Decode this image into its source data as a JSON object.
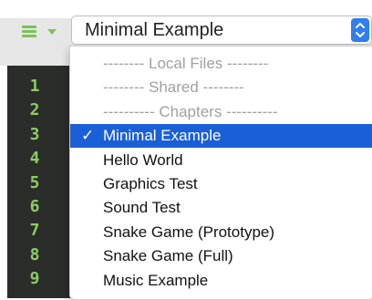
{
  "toolbar": {
    "selected_file": "Minimal Example"
  },
  "line_numbers": [
    "1",
    "2",
    "3",
    "4",
    "5",
    "6",
    "7",
    "8",
    "9"
  ],
  "menu": {
    "items": [
      {
        "label": "-------- Local Files --------",
        "type": "header"
      },
      {
        "label": "-------- Shared --------",
        "type": "header"
      },
      {
        "label": "---------- Chapters ----------",
        "type": "header"
      },
      {
        "label": "Minimal Example",
        "type": "item",
        "selected": true,
        "check": "✓"
      },
      {
        "label": "Hello World",
        "type": "item"
      },
      {
        "label": "Graphics Test",
        "type": "item"
      },
      {
        "label": "Sound Test",
        "type": "item"
      },
      {
        "label": "Snake Game (Prototype)",
        "type": "item"
      },
      {
        "label": "Snake Game (Full)",
        "type": "item"
      },
      {
        "label": "Music Example",
        "type": "item"
      }
    ]
  },
  "colors": {
    "accent": "#1a5fd8",
    "line_number_green": "#8ccd63",
    "editor_bg": "#2b2d2a"
  }
}
